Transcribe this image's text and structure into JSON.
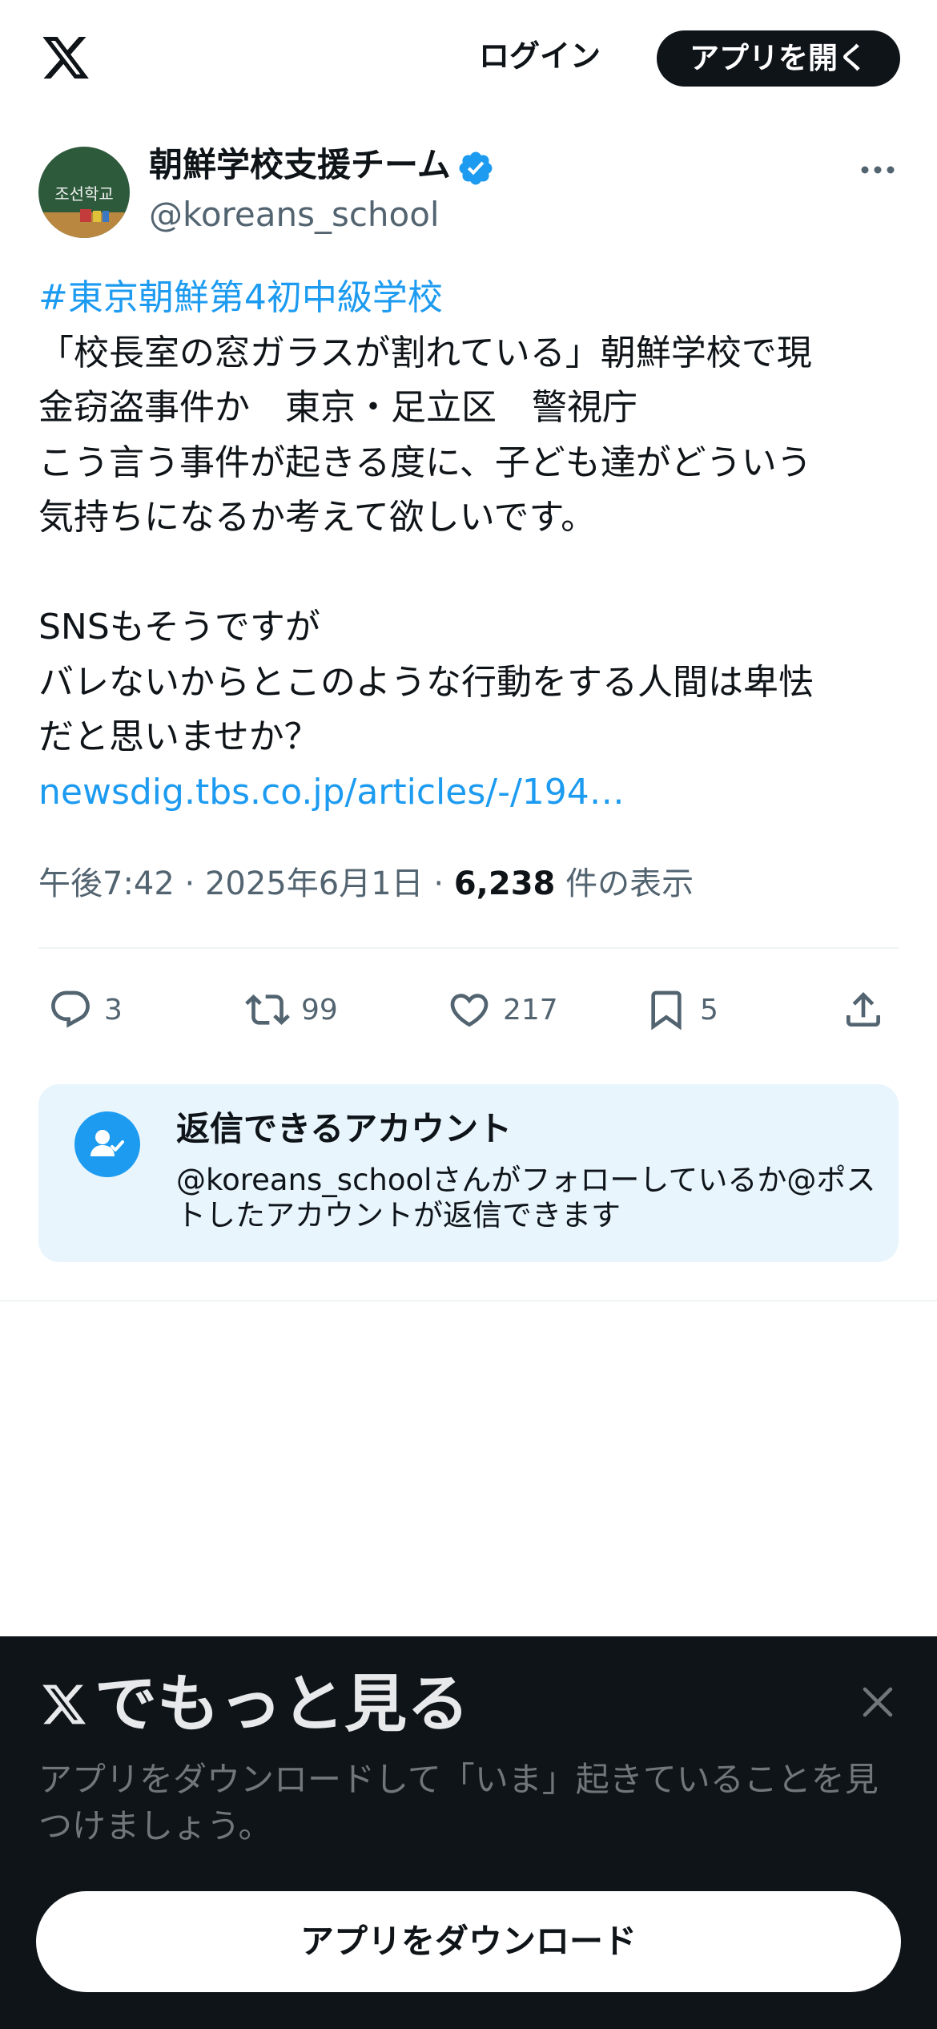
{
  "header": {
    "logo_icon": "x-logo-icon",
    "login_label": "ログイン",
    "open_app_label": "アプリを開く"
  },
  "post": {
    "author": {
      "display_name": "朝鮮学校支援チーム",
      "handle": "@koreans_school",
      "verified": true,
      "avatar_text": "조선학교"
    },
    "text": {
      "hashtag": "#東京朝鮮第4初中級学校",
      "line1": "「校長室の窓ガラスが割れている」朝鮮学校で現",
      "line2": "金窃盗事件か　東京・足立区　警視庁",
      "line3": "こう言う事件が起きる度に、子ども達がどういう",
      "line4": "気持ちになるか考えて欲しいです。",
      "line5": "SNSもそうですが",
      "line6": "バレないからとこのような行動をする人間は卑怯",
      "line7": "だと思いませか？",
      "link": "newsdig.tbs.co.jp/articles/-/194…"
    },
    "meta": {
      "time": "午後7:42",
      "separator": "·",
      "date": "2025年6月1日",
      "views_count": "6,238",
      "views_label": "件の表示"
    },
    "actions": {
      "replies": "3",
      "reposts": "99",
      "likes": "217",
      "bookmarks": "5"
    }
  },
  "reply_restriction": {
    "title": "返信できるアカウント",
    "description": "@koreans_schoolさんがフォローしているか@ポストしたアカウントが返信できます"
  },
  "bottom_sheet": {
    "title": "でもっと見る",
    "description": "アプリをダウンロードして「いま」起きていることを見つけましょう。",
    "download_label": "アプリをダウンロード"
  },
  "colors": {
    "accent": "#1d9bf0",
    "text_primary": "#0f1419",
    "text_secondary": "#536471",
    "sheet_background": "#0f1419"
  }
}
